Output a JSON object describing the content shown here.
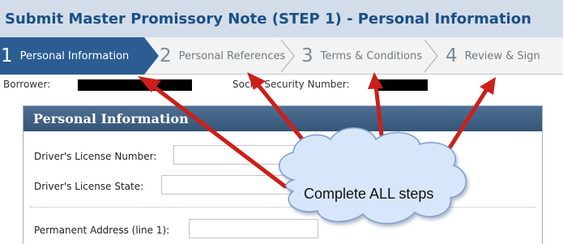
{
  "title": "Submit Master Promissory Note (STEP 1) - Personal Information",
  "steps": [
    {
      "number": "1",
      "label": "Personal Information",
      "active": true
    },
    {
      "number": "2",
      "label": "Personal References",
      "active": false
    },
    {
      "number": "3",
      "label": "Terms & Conditions",
      "active": false
    },
    {
      "number": "4",
      "label": "Review & Sign",
      "active": false
    }
  ],
  "borrower": {
    "borrower_label": "Borrower:",
    "ssn_label": "Social Security Number:"
  },
  "panel": {
    "title": "Personal Information",
    "fields": {
      "license_number_label": "Driver's License Number:",
      "license_state_label": "Driver's License State:",
      "address_line1_label": "Permanent Address (line 1):"
    }
  },
  "annotation": {
    "text": "Complete ALL steps",
    "arrow_color": "#cc1f1a",
    "bubble_color": "#d7e6fb"
  },
  "colors": {
    "title_bar": "#d2dde9",
    "title_text": "#1b4f86",
    "active_step": "#2b5d93",
    "panel_header": "#3f6186"
  }
}
